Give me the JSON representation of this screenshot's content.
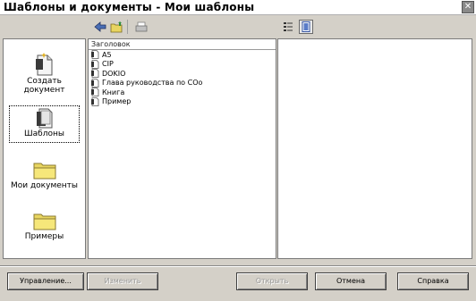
{
  "window": {
    "title": "Шаблоны и документы - Мои шаблоны",
    "close_glyph": "✕"
  },
  "sidebar": {
    "items": [
      {
        "label": "Создать\nдокумент",
        "icon": "new-document-icon",
        "selected": false
      },
      {
        "label": "Шаблоны",
        "icon": "templates-icon",
        "selected": true
      },
      {
        "label": "Мои документы",
        "icon": "folder-icon",
        "selected": false
      },
      {
        "label": "Примеры",
        "icon": "folder-icon",
        "selected": false
      }
    ]
  },
  "toolbar": {
    "buttons": [
      "back-icon",
      "up-folder-icon",
      "print-icon",
      "document-properties-icon",
      "preview-icon"
    ]
  },
  "filelist": {
    "header": "Заголовок",
    "rows": [
      "A5",
      "CIP",
      "DOKIO",
      "Глава руководства по COо",
      "Книга",
      "Пример"
    ]
  },
  "buttons": {
    "manage": "Управление...",
    "edit": "Изменить",
    "open": "Открыть",
    "cancel": "Отмена",
    "help": "Справка"
  },
  "colors": {
    "folder": "#f2e06a",
    "background": "#d4d0c8"
  }
}
